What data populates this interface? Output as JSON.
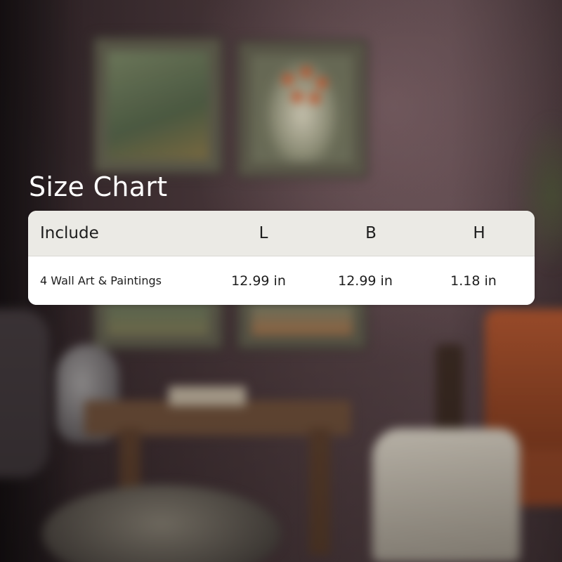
{
  "title": "Size Chart",
  "table": {
    "headers": [
      "Include",
      "L",
      "B",
      "H"
    ],
    "rows": [
      [
        "4 Wall Art & Paintings",
        "12.99 in",
        "12.99 in",
        "1.18 in"
      ]
    ]
  },
  "colors": {
    "title_text": "#ffffff",
    "header_background": "#ebeae5",
    "row_background": "#ffffff",
    "table_text": "#1d1d1d"
  }
}
